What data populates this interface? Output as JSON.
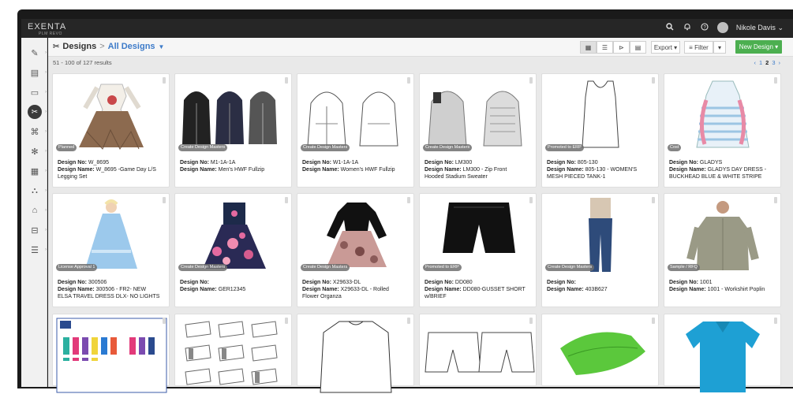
{
  "app": {
    "logo": "EXENTA",
    "logo_sub": "PLM REVO",
    "user_name": "Nikole Davis",
    "user_caret": "⌄"
  },
  "colors": {
    "accent_link": "#3d7bc9",
    "new_button": "#4caf50",
    "topbar": "#262626"
  },
  "sidebar": {
    "items": [
      {
        "icon": "style-icon"
      },
      {
        "icon": "document-icon"
      },
      {
        "icon": "image-icon"
      },
      {
        "icon": "designs-icon",
        "active": true
      },
      {
        "icon": "shirt-icon"
      },
      {
        "icon": "color-icon"
      },
      {
        "icon": "calculator-icon"
      },
      {
        "icon": "workflow-icon"
      },
      {
        "icon": "tag-icon"
      },
      {
        "icon": "ruler-icon"
      },
      {
        "icon": "report-icon"
      }
    ]
  },
  "header": {
    "section": "Designs",
    "separator": ">",
    "view": "All Designs",
    "export_label": "Export",
    "filter_label": "Filter",
    "new_label": "New Design",
    "results": "51 - 100 of 127 results",
    "pager": {
      "prev": "‹",
      "pages": [
        "1",
        "2",
        "3"
      ],
      "current": "2",
      "next": "›"
    }
  },
  "labels": {
    "design_no": "Design No:",
    "design_name": "Design Name:"
  },
  "cards": [
    {
      "badge": "Planned",
      "no": "W_8695",
      "name": "W_8695 -Game Day L/S",
      "name2": "Legging Set",
      "img": "dress"
    },
    {
      "badge": "Create Design Masters",
      "no": "M1-1A-1A",
      "name": "Men's HWF Fullzip",
      "name2": "",
      "img": "hoodies"
    },
    {
      "badge": "Create Design Masters",
      "no": "W1-1A-1A",
      "name": "Women's HWF Fullzip",
      "name2": "",
      "img": "hoodie-sketch"
    },
    {
      "badge": "Create Design Masters",
      "no": "LM300",
      "name": "LM300 - Zip Front",
      "name2": "Hooded Stadium Sweater",
      "img": "sweater"
    },
    {
      "badge": "Promoted to ERP",
      "no": "805-130",
      "name": "805-130 - WOMEN'S",
      "name2": "MESH PIECED TANK-1",
      "img": "tank"
    },
    {
      "badge": "Cost",
      "no": "GLADYS",
      "name": "GLADYS DAY DRESS -",
      "name2": "BUCKHEAD BLUE & WHITE STRIPE",
      "img": "stripe-dress"
    },
    {
      "badge": "License Approval 1",
      "no": "300506",
      "name": "300506 - FR2- NEW",
      "name2": "ELSA TRAVEL DRESS DLX- NO LIGHTS",
      "img": "elsa"
    },
    {
      "badge": "Create Design Masters",
      "no": "",
      "name": "GER12345",
      "name2": "",
      "img": "floral-dress"
    },
    {
      "badge": "Create Design Masters",
      "no": "X29633-DL",
      "name": "X29633-DL - Rolled",
      "name2": "Flower Organza",
      "img": "organza"
    },
    {
      "badge": "Promoted to ERP",
      "no": "DD080",
      "name": "DD080-GUSSET SHORT",
      "name2": "w/BRIEF",
      "img": "shorts"
    },
    {
      "badge": "Create Design Masters",
      "no": "",
      "name": "403B627",
      "name2": "",
      "img": "jeans"
    },
    {
      "badge": "Sample / RFQ",
      "no": "1001",
      "name": "1001 - Workshirt Poplin",
      "name2": "",
      "img": "workshirt"
    },
    {
      "badge": "",
      "no": "",
      "name": "",
      "name2": "",
      "img": "socks-sheet"
    },
    {
      "badge": "",
      "no": "",
      "name": "",
      "name2": "",
      "img": "socks"
    },
    {
      "badge": "",
      "no": "",
      "name": "",
      "name2": "",
      "img": "longsleeve"
    },
    {
      "badge": "",
      "no": "",
      "name": "",
      "name2": "",
      "img": "shorts-sketch"
    },
    {
      "badge": "",
      "no": "",
      "name": "",
      "name2": "",
      "img": "dog-vest"
    },
    {
      "badge": "",
      "no": "",
      "name": "",
      "name2": "",
      "img": "polo"
    }
  ]
}
